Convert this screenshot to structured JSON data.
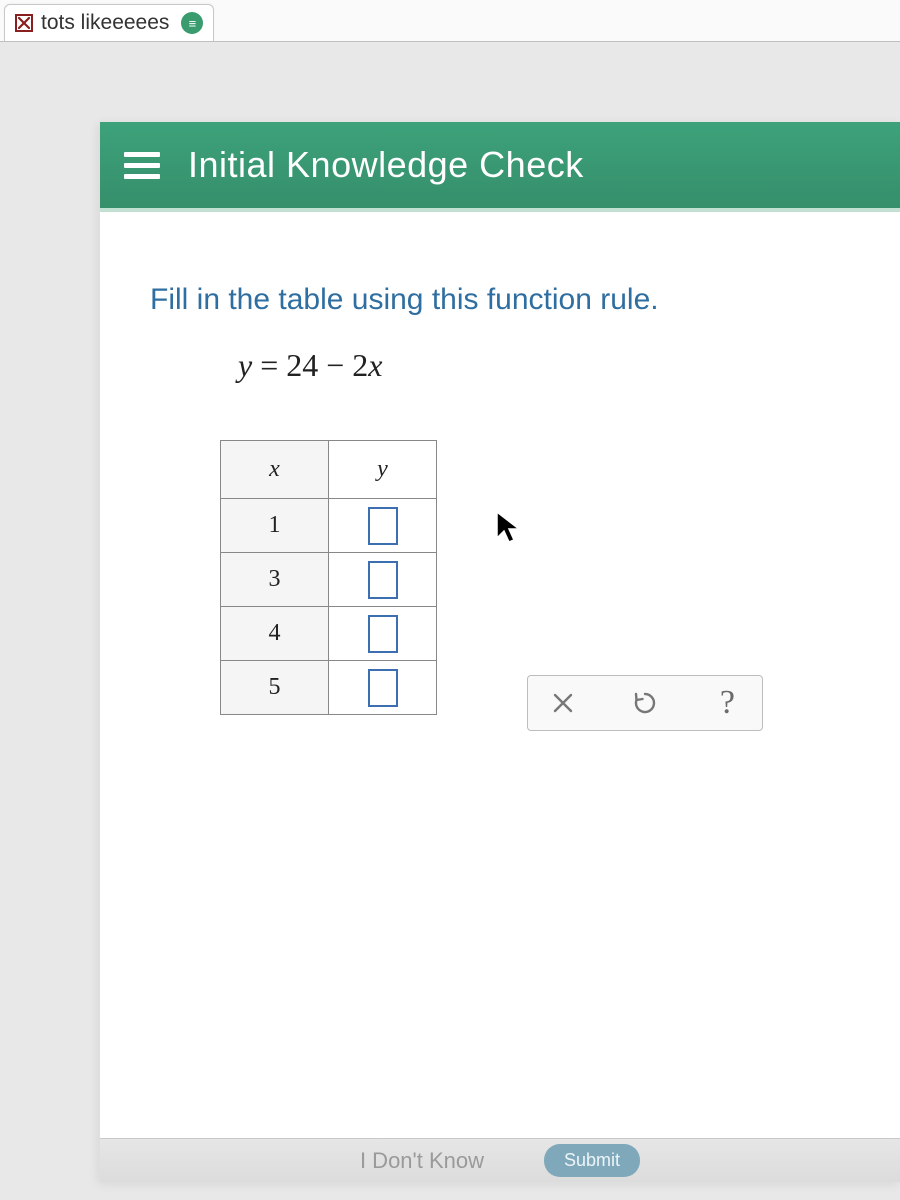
{
  "tab": {
    "title": "tots likeeeees"
  },
  "header": {
    "title": "Initial Knowledge Check"
  },
  "question": {
    "prompt": "Fill in the table using this function rule.",
    "equation_display": "y = 24 − 2x"
  },
  "table": {
    "headers": {
      "x": "x",
      "y": "y"
    },
    "rows": [
      {
        "x": "1",
        "y": ""
      },
      {
        "x": "3",
        "y": ""
      },
      {
        "x": "4",
        "y": ""
      },
      {
        "x": "5",
        "y": ""
      }
    ]
  },
  "footer": {
    "idk": "I Don't Know",
    "submit": "Submit"
  },
  "chart_data": {
    "type": "table",
    "title": "Function rule y = 24 - 2x",
    "columns": [
      "x",
      "y"
    ],
    "rows": [
      {
        "x": 1,
        "y": null
      },
      {
        "x": 3,
        "y": null
      },
      {
        "x": 4,
        "y": null
      },
      {
        "x": 5,
        "y": null
      }
    ]
  }
}
